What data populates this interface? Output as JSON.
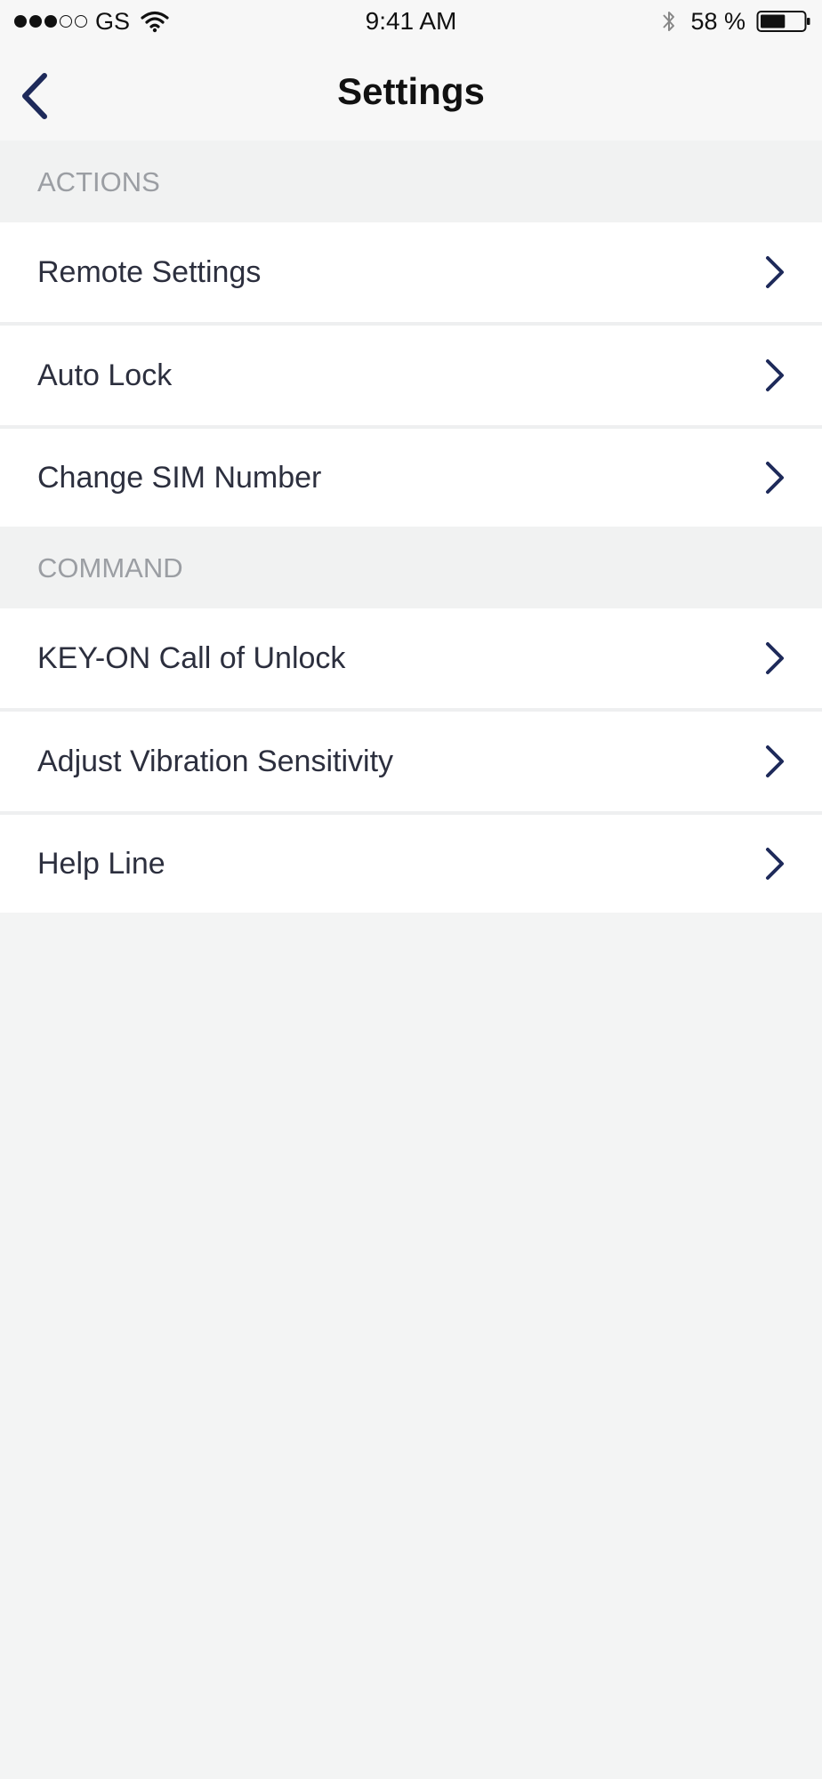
{
  "status_bar": {
    "carrier": "GS",
    "time": "9:41 AM",
    "battery_percent": "58 %",
    "signal_bars_full": 3,
    "signal_bars_total": 5,
    "battery_level": 0.58
  },
  "nav": {
    "title": "Settings"
  },
  "sections": [
    {
      "header": "ACTIONS",
      "items": [
        {
          "label": "Remote Settings"
        },
        {
          "label": "Auto Lock"
        },
        {
          "label": "Change SIM Number"
        }
      ]
    },
    {
      "header": "COMMAND",
      "items": [
        {
          "label": "KEY-ON Call of Unlock"
        },
        {
          "label": "Adjust Vibration Sensitivity"
        },
        {
          "label": "Help Line"
        }
      ]
    }
  ],
  "colors": {
    "accent": "#1e2a5a",
    "background": "#f3f4f4",
    "row_background": "#ffffff",
    "section_header_text": "#9b9ea3",
    "row_text": "#2c2f3e"
  },
  "icons": {
    "back": "chevron-left-icon",
    "row_chevron": "chevron-right-icon",
    "wifi": "wifi-icon",
    "bluetooth": "bluetooth-icon",
    "battery": "battery-icon"
  }
}
